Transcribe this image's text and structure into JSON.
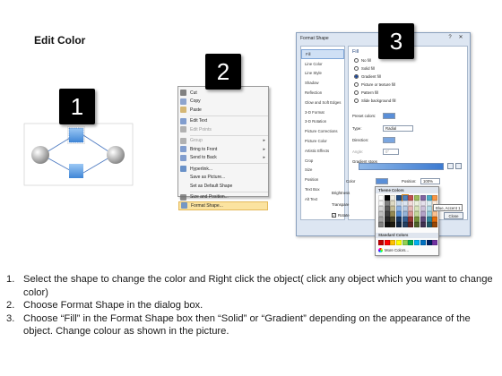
{
  "title": "Edit Color",
  "badges": {
    "one": "1",
    "two": "2",
    "three": "3"
  },
  "context_menu": {
    "items": [
      {
        "label": "Cut",
        "underline_label": "Cut",
        "icon": "scissors-icon",
        "dim": false,
        "submenu": false,
        "selected": false
      },
      {
        "label": "Copy",
        "icon": "copy-icon",
        "dim": false,
        "submenu": false,
        "selected": false
      },
      {
        "label": "Paste",
        "icon": "paste-icon",
        "dim": false,
        "submenu": false,
        "selected": false
      },
      {
        "label": "Edit Text",
        "icon": "edit-text-icon",
        "dim": false,
        "submenu": false,
        "selected": false
      },
      {
        "label": "Edit Points",
        "icon": "edit-points-icon",
        "dim": true,
        "submenu": false,
        "selected": false
      },
      {
        "label": "Group",
        "icon": "group-icon",
        "dim": true,
        "submenu": true,
        "selected": false
      },
      {
        "label": "Bring to Front",
        "icon": "bring-front-icon",
        "dim": false,
        "submenu": true,
        "selected": false
      },
      {
        "label": "Send to Back",
        "icon": "send-back-icon",
        "dim": false,
        "submenu": true,
        "selected": false
      },
      {
        "label": "Hyperlink...",
        "icon": "hyperlink-icon",
        "dim": false,
        "submenu": false,
        "selected": false
      },
      {
        "label": "Save as Picture...",
        "icon": "",
        "dim": false,
        "submenu": false,
        "selected": false
      },
      {
        "label": "Set as Default Shape",
        "icon": "",
        "dim": false,
        "submenu": false,
        "selected": false
      },
      {
        "label": "Size and Position...",
        "icon": "size-position-icon",
        "dim": false,
        "submenu": false,
        "selected": false
      },
      {
        "label": "Format Shape...",
        "icon": "format-shape-icon",
        "dim": false,
        "submenu": false,
        "selected": true
      }
    ]
  },
  "dialog": {
    "title": "Format Shape",
    "close": "✕",
    "help": "?",
    "nav": [
      "Fill",
      "Line Color",
      "Line Style",
      "Shadow",
      "Reflection",
      "Glow and Soft Edges",
      "3-D Format",
      "3-D Rotation",
      "Picture Corrections",
      "Picture Color",
      "Artistic Effects",
      "Crop",
      "Size",
      "Position",
      "Text Box",
      "Alt Text"
    ],
    "section": "Fill",
    "fill_options": [
      {
        "label": "No fill",
        "on": false
      },
      {
        "label": "Solid fill",
        "on": false
      },
      {
        "label": "Gradient fill",
        "on": true
      },
      {
        "label": "Picture or texture fill",
        "on": false
      },
      {
        "label": "Pattern fill",
        "on": false
      },
      {
        "label": "Slide background fill",
        "on": false
      }
    ],
    "preset_colors_label": "Preset colors:",
    "type_label": "Type:",
    "type_value": "Radial",
    "direction_label": "Direction:",
    "angle_label": "Angle:",
    "angle_value": "0°",
    "gradient_stops_label": "Gradient stops",
    "color_label": "Color",
    "position_label": "Position:",
    "position_value": "100%",
    "brightness_label": "Brightness",
    "transparency_label": "Transpare",
    "rotate_label": "Rotate",
    "close_button": "Close"
  },
  "picker": {
    "theme_header": "Theme Colors",
    "standard_header": "Standard Colors",
    "more_colors": "More Colors...",
    "tooltip": "Blue, Accent 1",
    "theme_top": [
      "#ffffff",
      "#000000",
      "#eeece1",
      "#1f497d",
      "#4f81bd",
      "#c0504d",
      "#9bbb59",
      "#8064a2",
      "#4bacc6",
      "#f79646"
    ],
    "theme_rows": [
      [
        "#f2f2f2",
        "#7f7f7f",
        "#ddd9c3",
        "#c6d9f0",
        "#dbe5f1",
        "#f2dcdb",
        "#ebf1dd",
        "#e5e0ec",
        "#dbeef3",
        "#fdeada"
      ],
      [
        "#d8d8d8",
        "#595959",
        "#c4bd97",
        "#8db3e2",
        "#b8cce4",
        "#e5b9b7",
        "#d7e3bc",
        "#ccc1d9",
        "#b7dde8",
        "#fbd5b5"
      ],
      [
        "#bfbfbf",
        "#3f3f3f",
        "#938953",
        "#548dd4",
        "#95b3d7",
        "#d99694",
        "#c3d69b",
        "#b2a2c7",
        "#92cddc",
        "#fac08f"
      ],
      [
        "#a5a5a5",
        "#262626",
        "#494429",
        "#17365d",
        "#366092",
        "#953734",
        "#76923c",
        "#5f497a",
        "#31859b",
        "#e36c09"
      ],
      [
        "#7f7f7f",
        "#0c0c0c",
        "#1d1b10",
        "#0f243e",
        "#244061",
        "#632423",
        "#4f6128",
        "#3f3151",
        "#205867",
        "#974806"
      ]
    ],
    "standard": [
      "#c00000",
      "#ff0000",
      "#ffc000",
      "#ffff00",
      "#92d050",
      "#00b050",
      "#00b0f0",
      "#0070c0",
      "#002060",
      "#7030a0"
    ]
  },
  "steps": [
    {
      "num": "1.",
      "text": "Select the shape to change the color and Right click the object( click any object which you want to change color)"
    },
    {
      "num": "2.",
      "text": "Choose Format Shape in the dialog box."
    },
    {
      "num": "3.",
      "text": "Choose “Fill” in the Format Shape box then “Solid” or “Gradient” depending on the appearance of the object. Change colour as shown in the picture."
    }
  ]
}
